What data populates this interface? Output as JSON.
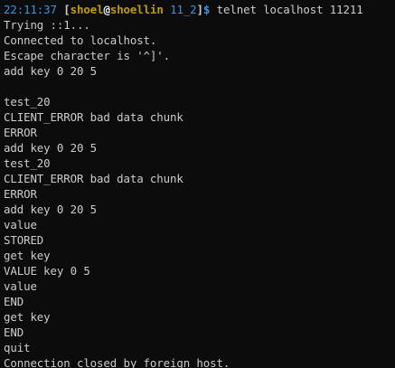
{
  "prompt": {
    "time": "22:11:37",
    "open_bracket": "[",
    "user": "shoel",
    "at": "@",
    "host": "shoellin",
    "cwd": "11_2",
    "close_bracket": "]",
    "dollar": "$",
    "command": "telnet localhost 11211"
  },
  "output_lines": [
    "Trying ::1...",
    "Connected to localhost.",
    "Escape character is '^]'.",
    "add key 0 20 5",
    "",
    "test_20",
    "CLIENT_ERROR bad data chunk",
    "ERROR",
    "add key 0 20 5",
    "test_20",
    "CLIENT_ERROR bad data chunk",
    "ERROR",
    "add key 0 20 5",
    "value",
    "STORED",
    "get key",
    "VALUE key 0 5",
    "value",
    "END",
    "get key",
    "END",
    "quit",
    "Connection closed by foreign host."
  ],
  "colors": {
    "background": "#0c0c0c",
    "foreground": "#cccccc",
    "time": "#3a96dd",
    "user_host": "#c19c00",
    "cwd": "#3a96dd",
    "dollar": "#3a96dd"
  }
}
